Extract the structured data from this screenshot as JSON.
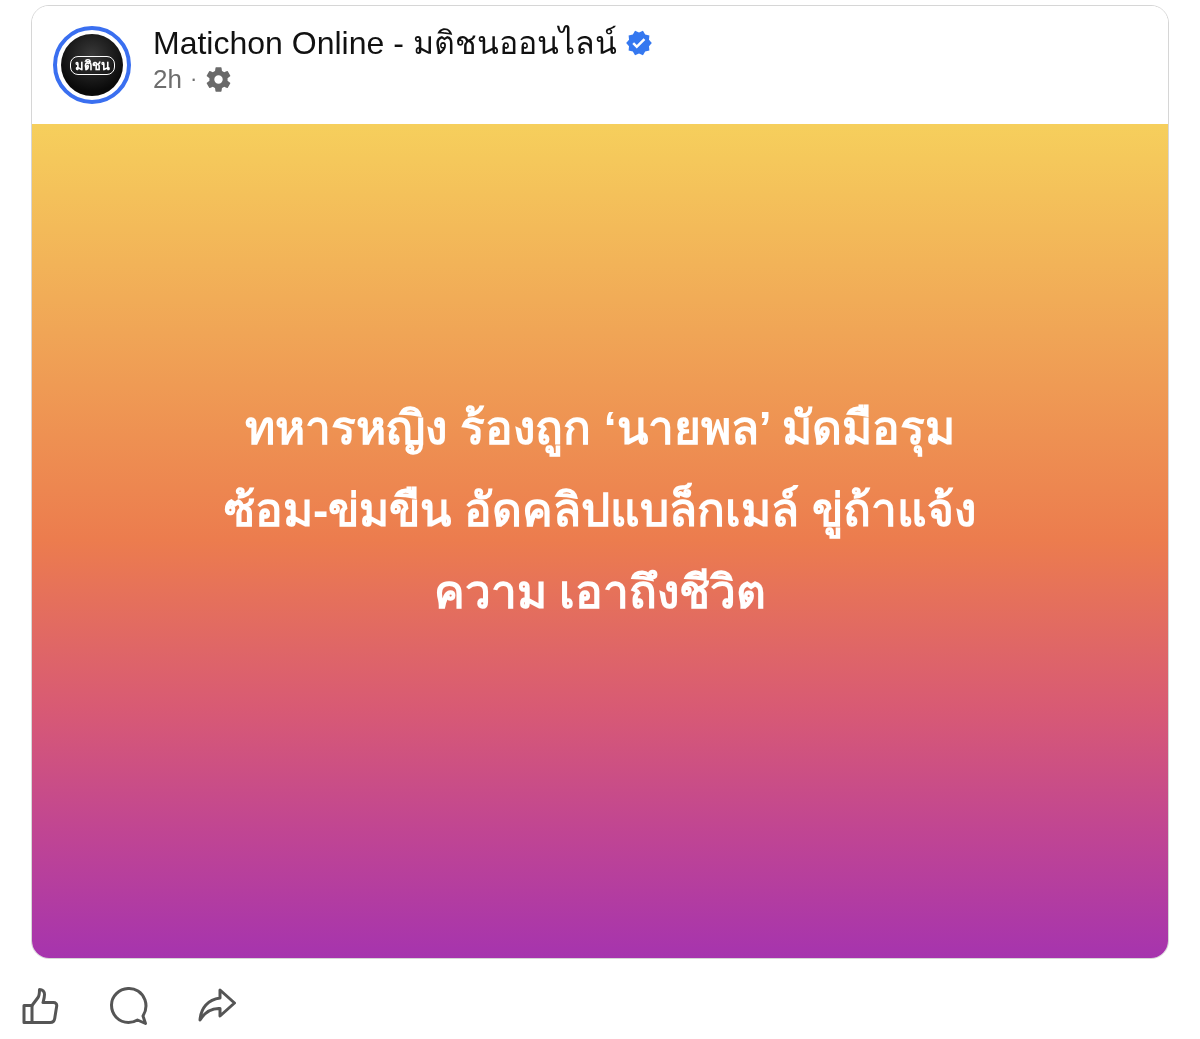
{
  "post": {
    "page_name": "Matichon Online - มติชนออนไลน์",
    "verified": true,
    "avatar_logo": "มติชน",
    "time": "2h",
    "separator": "·",
    "headline": "ทหารหญิง ร้องถูก ‘นายพล’ มัดมือรุม\nซ้อม-ข่มขืน อัดคลิปแบล็กเมล์ ขู่ถ้าแจ้ง\nความ เอาถึงชีวิต"
  },
  "actions": [
    {
      "kind": "like"
    },
    {
      "kind": "comment"
    },
    {
      "kind": "share"
    }
  ]
}
